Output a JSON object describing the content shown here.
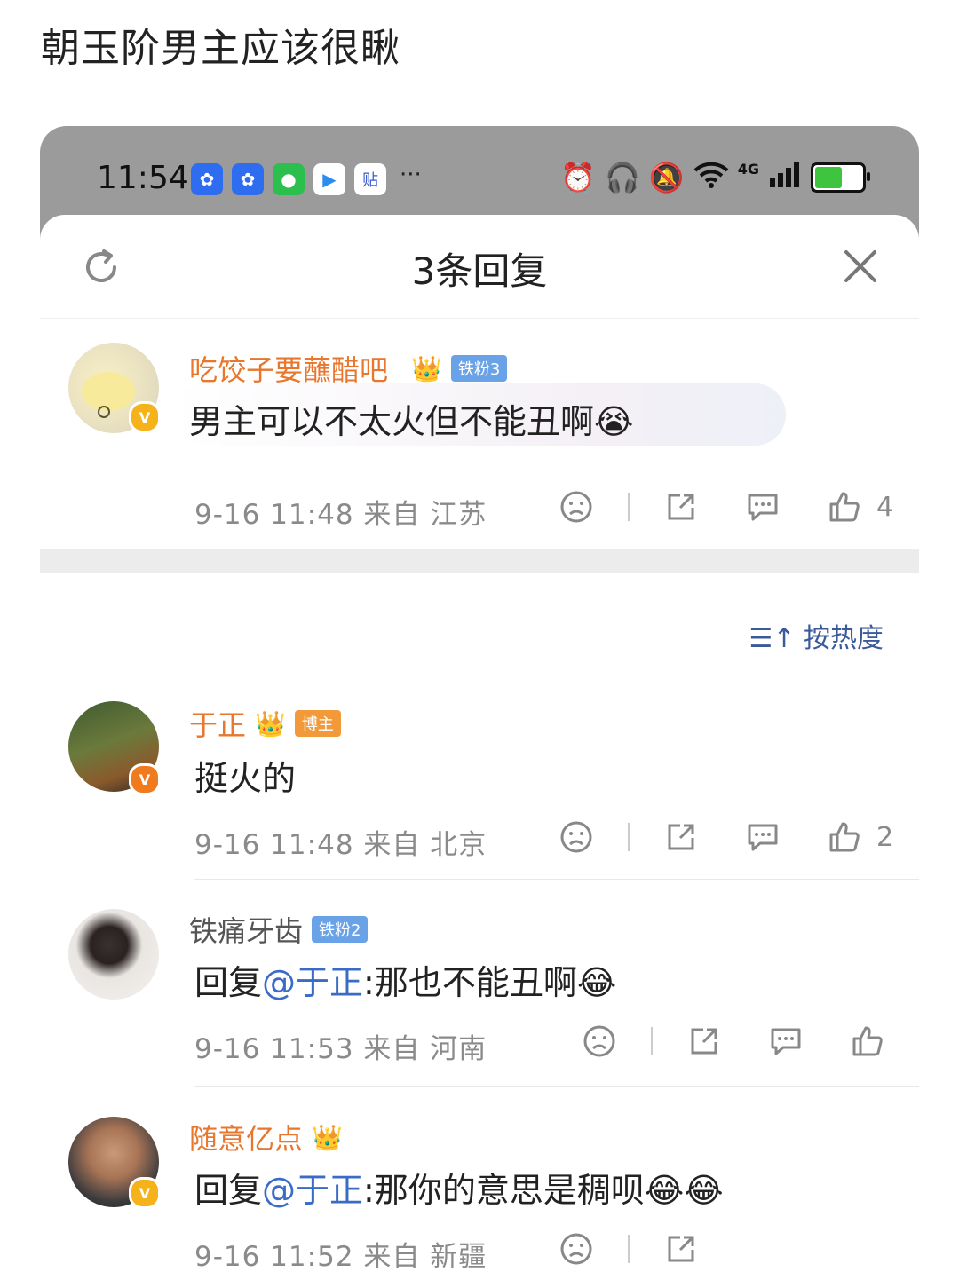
{
  "post": {
    "title": "朝玉阶男主应该很瞅"
  },
  "statusbar": {
    "time": "11:54",
    "more": "···",
    "net_label": "4G",
    "apps": [
      {
        "name": "baidu-netdisk-icon",
        "color": "#2f6df0",
        "glyph": "✿"
      },
      {
        "name": "baidu-netdisk-icon",
        "color": "#2f6df0",
        "glyph": "✿"
      },
      {
        "name": "wechat-icon",
        "color": "#2bbf4e",
        "glyph": "●"
      },
      {
        "name": "video-player-icon",
        "color": "#ffffff",
        "glyph": "▶"
      },
      {
        "name": "tieba-icon",
        "color": "#ffffff",
        "glyph": "贴"
      }
    ]
  },
  "sheet": {
    "title": "3条回复"
  },
  "root_comment": {
    "username": "吃饺子要蘸醋吧_",
    "badge": "铁粉3",
    "text": "男主可以不太火但不能丑啊",
    "emoji": "😭",
    "meta": "9-16 11:48  来自 江苏",
    "likes": "4"
  },
  "sort": {
    "label": "按热度"
  },
  "replies": [
    {
      "username": "于正",
      "badge": "博主",
      "text": "挺火的",
      "meta": "9-16 11:48  来自 北京",
      "likes": "2"
    },
    {
      "username": "铁痛牙齿",
      "badge": "铁粉2",
      "reply_prefix": "回复",
      "mention": "@于正",
      "text": ":那也不能丑啊",
      "emoji": "😂",
      "meta": "9-16 11:53  来自 河南",
      "likes": ""
    },
    {
      "username": "随意亿点",
      "reply_prefix": "回复",
      "mention": "@于正",
      "text": ":那你的意思是稠呗",
      "emoji": "😂😂",
      "meta": "9-16 11:52  来自 新疆",
      "likes": ""
    }
  ],
  "colors": {
    "accent_orange": "#e8762c",
    "mention_blue": "#3a6cc6",
    "verified_yellow": "#f5b21b",
    "verified_orange": "#f07a1e"
  }
}
